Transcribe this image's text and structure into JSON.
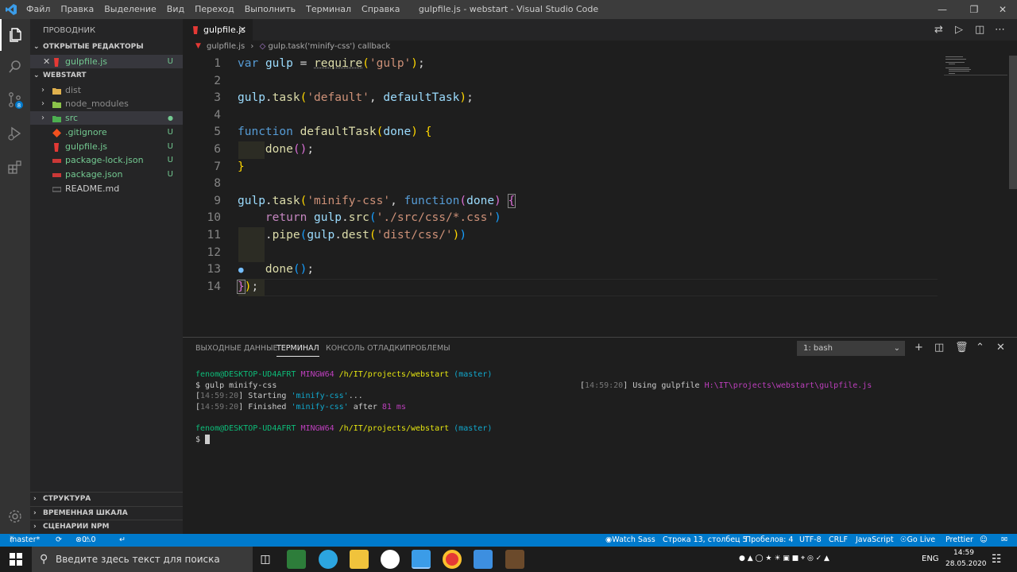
{
  "window": {
    "title": "gulpfile.js - webstart - Visual Studio Code"
  },
  "menu": [
    "Файл",
    "Правка",
    "Выделение",
    "Вид",
    "Переход",
    "Выполнить",
    "Терминал",
    "Справка"
  ],
  "sidebar": {
    "title": "ПРОВОДНИК",
    "open_editors": "ОТКРЫТЫЕ РЕДАКТОРЫ",
    "open_file": {
      "name": "gulpfile.js",
      "status": "U"
    },
    "project": "WEBSTART",
    "items": [
      {
        "name": "dist",
        "status": ""
      },
      {
        "name": "node_modules",
        "status": ""
      },
      {
        "name": "src",
        "status": "●"
      },
      {
        "name": ".gitignore",
        "status": "U"
      },
      {
        "name": "gulpfile.js",
        "status": "U"
      },
      {
        "name": "package-lock.json",
        "status": "U"
      },
      {
        "name": "package.json",
        "status": "U"
      },
      {
        "name": "README.md",
        "status": ""
      }
    ],
    "bottom": [
      "СТРУКТУРА",
      "ВРЕМЕННАЯ ШКАЛА",
      "СЦЕНАРИИ NPM"
    ]
  },
  "editor": {
    "tab": "gulpfile.js",
    "breadcrumb_file": "gulpfile.js",
    "breadcrumb_symbol": "gulp.task('minify-css') callback",
    "line_numbers": [
      "1",
      "2",
      "3",
      "4",
      "5",
      "6",
      "7",
      "8",
      "9",
      "10",
      "11",
      "12",
      "13",
      "14"
    ]
  },
  "panel": {
    "tabs": [
      "ВЫХОДНЫЕ ДАННЫЕ",
      "ТЕРМИНАЛ",
      "КОНСОЛЬ ОТЛАДКИ",
      "ПРОБЛЕМЫ"
    ],
    "terminal_select": "1: bash",
    "user": "fenom@DESKTOP-UD4AFRT",
    "env": "MINGW64",
    "path": "/h/IT/projects/webstart",
    "branch": "(master)",
    "cmd": "$ gulp minify-css",
    "t1": "14:59:20",
    "using": "Using gulpfile",
    "gulpfile_path": "H:\\IT\\projects\\webstart\\gulpfile.js",
    "starting": "Starting",
    "finished": "Finished",
    "task": "'minify-css'",
    "dots": "...",
    "after": "after",
    "ms": "81 ms",
    "prompt": "$"
  },
  "status": {
    "branch": "master*",
    "errors": "0",
    "warnings": "0",
    "watch_sass": "Watch Sass",
    "position": "Строка 13, столбец 5",
    "spaces": "Пробелов: 4",
    "encoding": "UTF-8",
    "eol": "CRLF",
    "language": "JavaScript",
    "golive": "Go Live",
    "prettier": "Prettier"
  },
  "taskbar": {
    "search_placeholder": "Введите здесь текст для поиска",
    "lang": "ENG",
    "time": "14:59",
    "date": "28.05.2020",
    "badge": "8"
  }
}
